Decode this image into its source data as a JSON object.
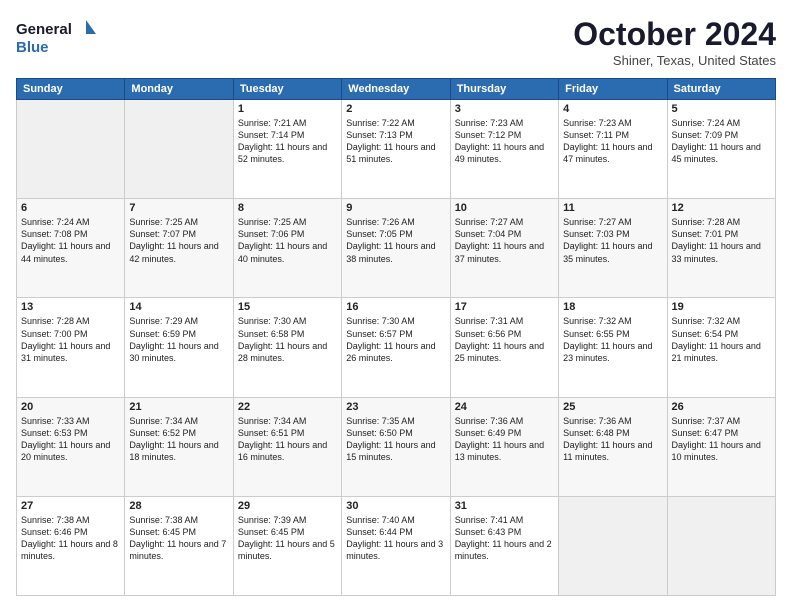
{
  "logo": {
    "line1": "General",
    "line2": "Blue"
  },
  "title": "October 2024",
  "location": "Shiner, Texas, United States",
  "days_of_week": [
    "Sunday",
    "Monday",
    "Tuesday",
    "Wednesday",
    "Thursday",
    "Friday",
    "Saturday"
  ],
  "weeks": [
    [
      {
        "day": "",
        "sunrise": "",
        "sunset": "",
        "daylight": ""
      },
      {
        "day": "",
        "sunrise": "",
        "sunset": "",
        "daylight": ""
      },
      {
        "day": "1",
        "sunrise": "Sunrise: 7:21 AM",
        "sunset": "Sunset: 7:14 PM",
        "daylight": "Daylight: 11 hours and 52 minutes."
      },
      {
        "day": "2",
        "sunrise": "Sunrise: 7:22 AM",
        "sunset": "Sunset: 7:13 PM",
        "daylight": "Daylight: 11 hours and 51 minutes."
      },
      {
        "day": "3",
        "sunrise": "Sunrise: 7:23 AM",
        "sunset": "Sunset: 7:12 PM",
        "daylight": "Daylight: 11 hours and 49 minutes."
      },
      {
        "day": "4",
        "sunrise": "Sunrise: 7:23 AM",
        "sunset": "Sunset: 7:11 PM",
        "daylight": "Daylight: 11 hours and 47 minutes."
      },
      {
        "day": "5",
        "sunrise": "Sunrise: 7:24 AM",
        "sunset": "Sunset: 7:09 PM",
        "daylight": "Daylight: 11 hours and 45 minutes."
      }
    ],
    [
      {
        "day": "6",
        "sunrise": "Sunrise: 7:24 AM",
        "sunset": "Sunset: 7:08 PM",
        "daylight": "Daylight: 11 hours and 44 minutes."
      },
      {
        "day": "7",
        "sunrise": "Sunrise: 7:25 AM",
        "sunset": "Sunset: 7:07 PM",
        "daylight": "Daylight: 11 hours and 42 minutes."
      },
      {
        "day": "8",
        "sunrise": "Sunrise: 7:25 AM",
        "sunset": "Sunset: 7:06 PM",
        "daylight": "Daylight: 11 hours and 40 minutes."
      },
      {
        "day": "9",
        "sunrise": "Sunrise: 7:26 AM",
        "sunset": "Sunset: 7:05 PM",
        "daylight": "Daylight: 11 hours and 38 minutes."
      },
      {
        "day": "10",
        "sunrise": "Sunrise: 7:27 AM",
        "sunset": "Sunset: 7:04 PM",
        "daylight": "Daylight: 11 hours and 37 minutes."
      },
      {
        "day": "11",
        "sunrise": "Sunrise: 7:27 AM",
        "sunset": "Sunset: 7:03 PM",
        "daylight": "Daylight: 11 hours and 35 minutes."
      },
      {
        "day": "12",
        "sunrise": "Sunrise: 7:28 AM",
        "sunset": "Sunset: 7:01 PM",
        "daylight": "Daylight: 11 hours and 33 minutes."
      }
    ],
    [
      {
        "day": "13",
        "sunrise": "Sunrise: 7:28 AM",
        "sunset": "Sunset: 7:00 PM",
        "daylight": "Daylight: 11 hours and 31 minutes."
      },
      {
        "day": "14",
        "sunrise": "Sunrise: 7:29 AM",
        "sunset": "Sunset: 6:59 PM",
        "daylight": "Daylight: 11 hours and 30 minutes."
      },
      {
        "day": "15",
        "sunrise": "Sunrise: 7:30 AM",
        "sunset": "Sunset: 6:58 PM",
        "daylight": "Daylight: 11 hours and 28 minutes."
      },
      {
        "day": "16",
        "sunrise": "Sunrise: 7:30 AM",
        "sunset": "Sunset: 6:57 PM",
        "daylight": "Daylight: 11 hours and 26 minutes."
      },
      {
        "day": "17",
        "sunrise": "Sunrise: 7:31 AM",
        "sunset": "Sunset: 6:56 PM",
        "daylight": "Daylight: 11 hours and 25 minutes."
      },
      {
        "day": "18",
        "sunrise": "Sunrise: 7:32 AM",
        "sunset": "Sunset: 6:55 PM",
        "daylight": "Daylight: 11 hours and 23 minutes."
      },
      {
        "day": "19",
        "sunrise": "Sunrise: 7:32 AM",
        "sunset": "Sunset: 6:54 PM",
        "daylight": "Daylight: 11 hours and 21 minutes."
      }
    ],
    [
      {
        "day": "20",
        "sunrise": "Sunrise: 7:33 AM",
        "sunset": "Sunset: 6:53 PM",
        "daylight": "Daylight: 11 hours and 20 minutes."
      },
      {
        "day": "21",
        "sunrise": "Sunrise: 7:34 AM",
        "sunset": "Sunset: 6:52 PM",
        "daylight": "Daylight: 11 hours and 18 minutes."
      },
      {
        "day": "22",
        "sunrise": "Sunrise: 7:34 AM",
        "sunset": "Sunset: 6:51 PM",
        "daylight": "Daylight: 11 hours and 16 minutes."
      },
      {
        "day": "23",
        "sunrise": "Sunrise: 7:35 AM",
        "sunset": "Sunset: 6:50 PM",
        "daylight": "Daylight: 11 hours and 15 minutes."
      },
      {
        "day": "24",
        "sunrise": "Sunrise: 7:36 AM",
        "sunset": "Sunset: 6:49 PM",
        "daylight": "Daylight: 11 hours and 13 minutes."
      },
      {
        "day": "25",
        "sunrise": "Sunrise: 7:36 AM",
        "sunset": "Sunset: 6:48 PM",
        "daylight": "Daylight: 11 hours and 11 minutes."
      },
      {
        "day": "26",
        "sunrise": "Sunrise: 7:37 AM",
        "sunset": "Sunset: 6:47 PM",
        "daylight": "Daylight: 11 hours and 10 minutes."
      }
    ],
    [
      {
        "day": "27",
        "sunrise": "Sunrise: 7:38 AM",
        "sunset": "Sunset: 6:46 PM",
        "daylight": "Daylight: 11 hours and 8 minutes."
      },
      {
        "day": "28",
        "sunrise": "Sunrise: 7:38 AM",
        "sunset": "Sunset: 6:45 PM",
        "daylight": "Daylight: 11 hours and 7 minutes."
      },
      {
        "day": "29",
        "sunrise": "Sunrise: 7:39 AM",
        "sunset": "Sunset: 6:45 PM",
        "daylight": "Daylight: 11 hours and 5 minutes."
      },
      {
        "day": "30",
        "sunrise": "Sunrise: 7:40 AM",
        "sunset": "Sunset: 6:44 PM",
        "daylight": "Daylight: 11 hours and 3 minutes."
      },
      {
        "day": "31",
        "sunrise": "Sunrise: 7:41 AM",
        "sunset": "Sunset: 6:43 PM",
        "daylight": "Daylight: 11 hours and 2 minutes."
      },
      {
        "day": "",
        "sunrise": "",
        "sunset": "",
        "daylight": ""
      },
      {
        "day": "",
        "sunrise": "",
        "sunset": "",
        "daylight": ""
      }
    ]
  ]
}
